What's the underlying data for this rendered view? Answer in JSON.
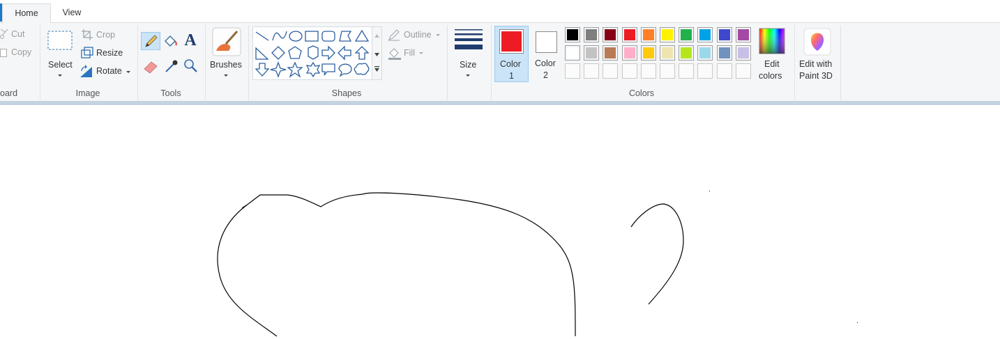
{
  "tabs": [
    {
      "label": "Home",
      "active": true
    },
    {
      "label": "View",
      "active": false
    }
  ],
  "clipboard": {
    "cut": "Cut",
    "copy": "Copy",
    "group_label": "oard"
  },
  "image": {
    "select": "Select",
    "crop": "Crop",
    "resize": "Resize",
    "rotate": "Rotate",
    "group_label": "Image"
  },
  "tools": {
    "group_label": "Tools"
  },
  "brushes": {
    "label": "Brushes"
  },
  "shapes": {
    "outline": "Outline",
    "fill": "Fill",
    "group_label": "Shapes"
  },
  "size": {
    "label": "Size"
  },
  "colors": {
    "color1_line1": "Color",
    "color1_line2": "1",
    "color2_line1": "Color",
    "color2_line2": "2",
    "color1": "#ed1c24",
    "color2": "#ffffff",
    "palette_row1": [
      "#000000",
      "#7f7f7f",
      "#880015",
      "#ed1c24",
      "#ff7f27",
      "#fff200",
      "#22b14c",
      "#00a2e8",
      "#3f48cc",
      "#a349a4"
    ],
    "palette_row2": [
      "#ffffff",
      "#c3c3c3",
      "#b97a57",
      "#ffaec9",
      "#ffc90e",
      "#efe4b0",
      "#b5e61d",
      "#99d9ea",
      "#7092be",
      "#c8bfe7"
    ],
    "edit_line1": "Edit",
    "edit_line2": "colors",
    "group_label": "Colors"
  },
  "paint3d": {
    "line1": "Edit with",
    "line2": "Paint 3D"
  }
}
